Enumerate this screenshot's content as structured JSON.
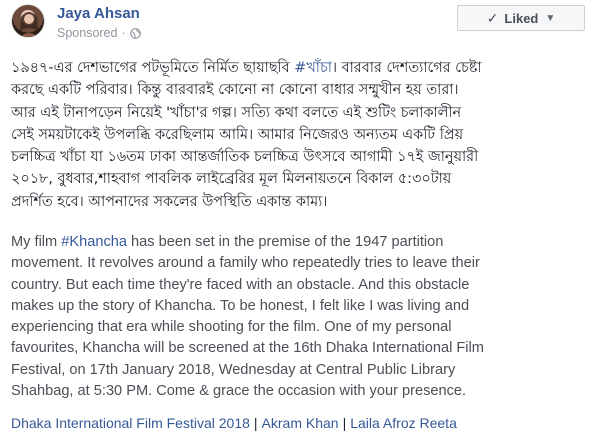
{
  "post": {
    "author": "Jaya Ahsan",
    "sponsored_label": "Sponsored",
    "meta_dot": "·",
    "liked_label": "Liked",
    "check_glyph": "✓",
    "caret_glyph": "▼"
  },
  "bangla_lines": [
    "১৯৪৭-এর দেশভাগের পটভূমিতে নির্মিত ছায়াছবি ",
    "করছে একটি পরিবার। কিন্তু বারবারই কোনো না কোনো বাধার সম্মুখীন হয় তারা।",
    "আর এই টানাপড়েন নিয়েই 'খাঁচা'র গল্প। সত্যি কথা বলতে এই শুটিং চলাকালীন",
    "সেই সময়টাকেই উপলব্ধি করেছিলাম আমি। আমার নিজেরও অন্যতম একটি প্রিয়",
    "চলচ্চিত্র খাঁচা যা ১৬তম ঢাকা আন্তর্জাতিক চলচ্চিত্র উৎসবে আগামী ১৭ই জানুয়ারী",
    "২০১৮, বুধবার,শাহবাগ পাবলিক লাইব্রেরির মূল মিলনায়তনে বিকাল ৫:৩০টায়",
    "প্রদর্শিত হবে। আপনাদের সকলের উপস্থিতি একান্ত কাম্য।"
  ],
  "bangla_hashtag": "#খাঁচা",
  "bangla_line1_tail": "। বারবার দেশত্যাগের চেষ্টা",
  "english_line1_pre": "My film ",
  "english_hashtag": "#Khancha",
  "english_line1_post": " has been set in the premise of the 1947 partition",
  "english_lines": [
    "movement. It revolves around a family who repeatedly tries to leave their",
    "country. But each time they're faced with an obstacle. And this obstacle",
    "makes up the story of Khancha. To be honest, I felt like I was living and",
    "experiencing that era while shooting for the film. One of my personal",
    "favourites, Khancha will be screened at the 16th Dhaka International Film",
    "Festival, on 17th January 2018, Wednesday at Central Public Library",
    "Shahbag, at 5:30 PM. Come & grace the occasion with your presence."
  ],
  "bottom_links": [
    "Dhaka International Film Festival 2018",
    "Akram Khan",
    "Laila Afroz Reeta"
  ],
  "separator": "|",
  "colors": {
    "link": "#365899",
    "meta": "#90949c",
    "text": "#1d2129"
  },
  "icons": {
    "privacy": "globe-icon",
    "liked": "check-icon",
    "dropdown": "caret-down-icon"
  }
}
